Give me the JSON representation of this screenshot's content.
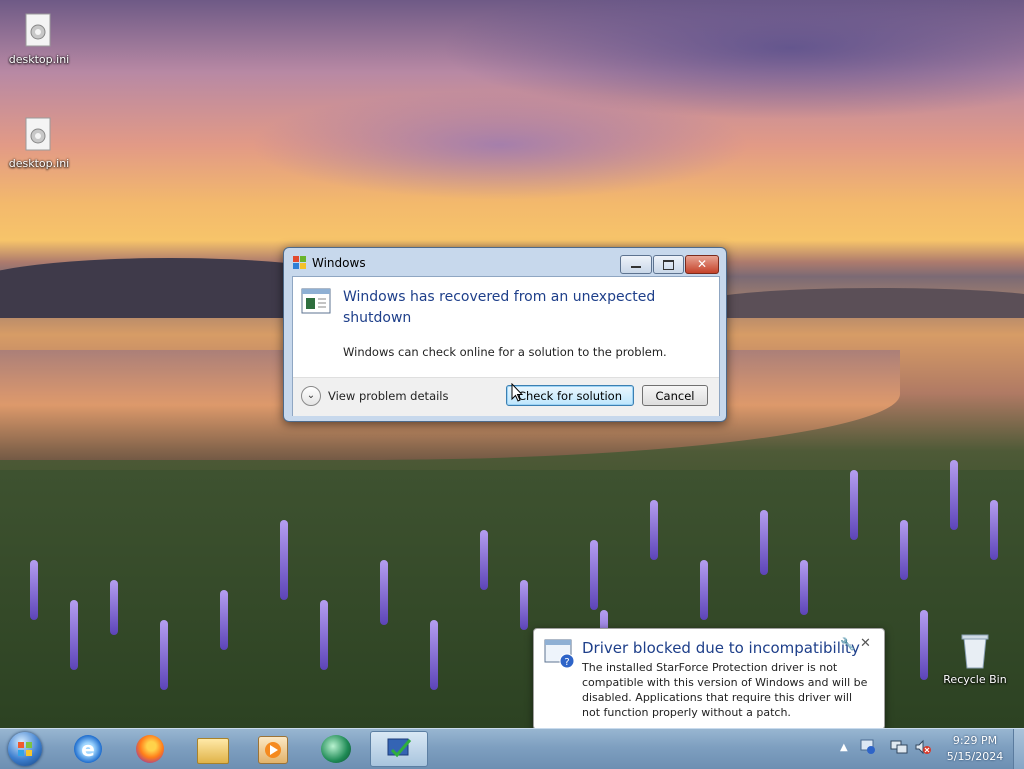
{
  "desktop": {
    "icons": [
      {
        "label": "desktop.ini",
        "icon": "ini-file-icon"
      },
      {
        "label": "desktop.ini",
        "icon": "ini-file-icon"
      },
      {
        "label": "Recycle Bin",
        "icon": "recycle-bin-icon"
      }
    ]
  },
  "dialog": {
    "title": "Windows",
    "heading": "Windows has recovered from an unexpected shutdown",
    "message": "Windows can check online for a solution to the problem.",
    "details_toggle": "View problem details",
    "check_button": "Check for solution",
    "cancel_button": "Cancel"
  },
  "notification": {
    "title": "Driver blocked due to incompatibility",
    "body": "The installed StarForce Protection driver is not compatible with this version of Windows and will be disabled.  Applications that require this driver will not function properly without a patch."
  },
  "taskbar": {
    "pinned": [
      "start-orb-icon",
      "internet-explorer-icon",
      "firefox-icon",
      "file-explorer-icon",
      "media-player-icon",
      "app-icon",
      "active-app-icon"
    ],
    "clock_time": "9:29 PM",
    "clock_date": "5/15/2024"
  },
  "colors": {
    "accent": "#1e3f8a",
    "taskbar": "#7e9fc0",
    "dialog_frame": "#c7d8ec"
  }
}
